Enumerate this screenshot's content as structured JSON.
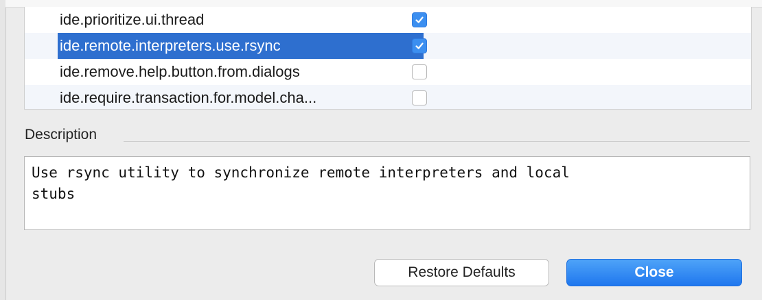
{
  "registry": {
    "rows": [
      {
        "key": "ide.prioritize.ui.thread",
        "checked": true,
        "selected": false
      },
      {
        "key": "ide.remote.interpreters.use.rsync",
        "checked": true,
        "selected": true
      },
      {
        "key": "ide.remove.help.button.from.dialogs",
        "checked": false,
        "selected": false
      },
      {
        "key": "ide.require.transaction.for.model.cha...",
        "checked": false,
        "selected": false
      }
    ]
  },
  "description": {
    "title": "Description",
    "text": "Use rsync utility to synchronize remote interpreters and local\nstubs"
  },
  "buttons": {
    "restore_label": "Restore Defaults",
    "close_label": "Close"
  },
  "colors": {
    "selection": "#2e6fcf",
    "checkbox_checked": "#3c8ff0",
    "primary_button": "#2a85f2"
  }
}
